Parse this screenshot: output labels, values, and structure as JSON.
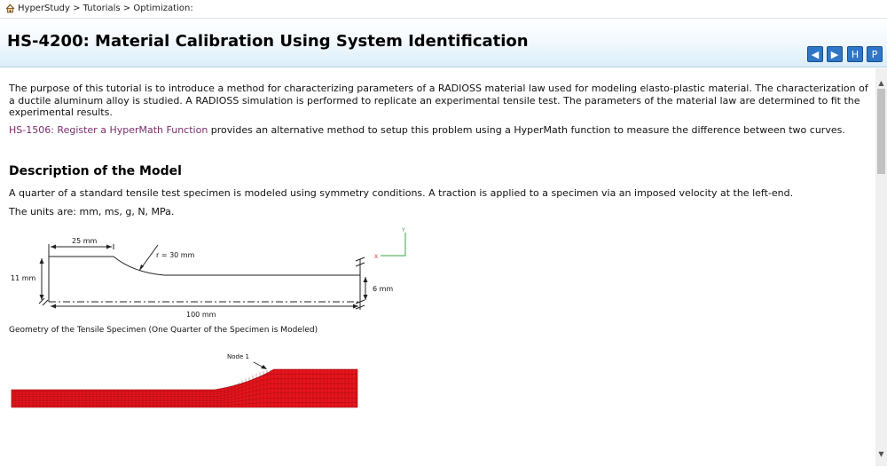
{
  "breadcrumb": {
    "text": "HyperStudy > Tutorials > Optimization:"
  },
  "header": {
    "title": "HS-4200: Material Calibration Using System Identification",
    "buttons": [
      "◀",
      "▶",
      "H",
      "P"
    ]
  },
  "content": {
    "intro": "The purpose of this tutorial is to introduce a method for characterizing parameters of a RADIOSS material law used for modeling elasto-plastic material. The characterization of a ductile aluminum alloy is studied. A RADIOSS simulation is performed to replicate an experimental tensile test. The parameters of the material law are determined to fit the experimental results.",
    "alt_link": "HS-1506: Register a HyperMath Function",
    "alt_text": " provides an alternative method to setup this problem using a HyperMath function to measure the difference between two curves.",
    "section_title": "Description of the Model",
    "description": "A quarter of a standard tensile test specimen is modeled using symmetry conditions. A traction is applied to a specimen via an imposed velocity at the left-end.",
    "units": "The units are: mm, ms, g, N, MPa.",
    "figure1": {
      "dim_length_top": "25 mm",
      "radius": "r = 30  mm",
      "height_left": "11 mm",
      "height_right": "6 mm",
      "length_total": "100  mm",
      "axis_y": "Y",
      "axis_x": "X"
    },
    "figure1_caption": "Geometry of the Tensile Specimen (One Quarter of the Specimen is Modeled)",
    "figure2": {
      "node_label": "Node 1",
      "mesh_color": "#e8141c"
    }
  }
}
